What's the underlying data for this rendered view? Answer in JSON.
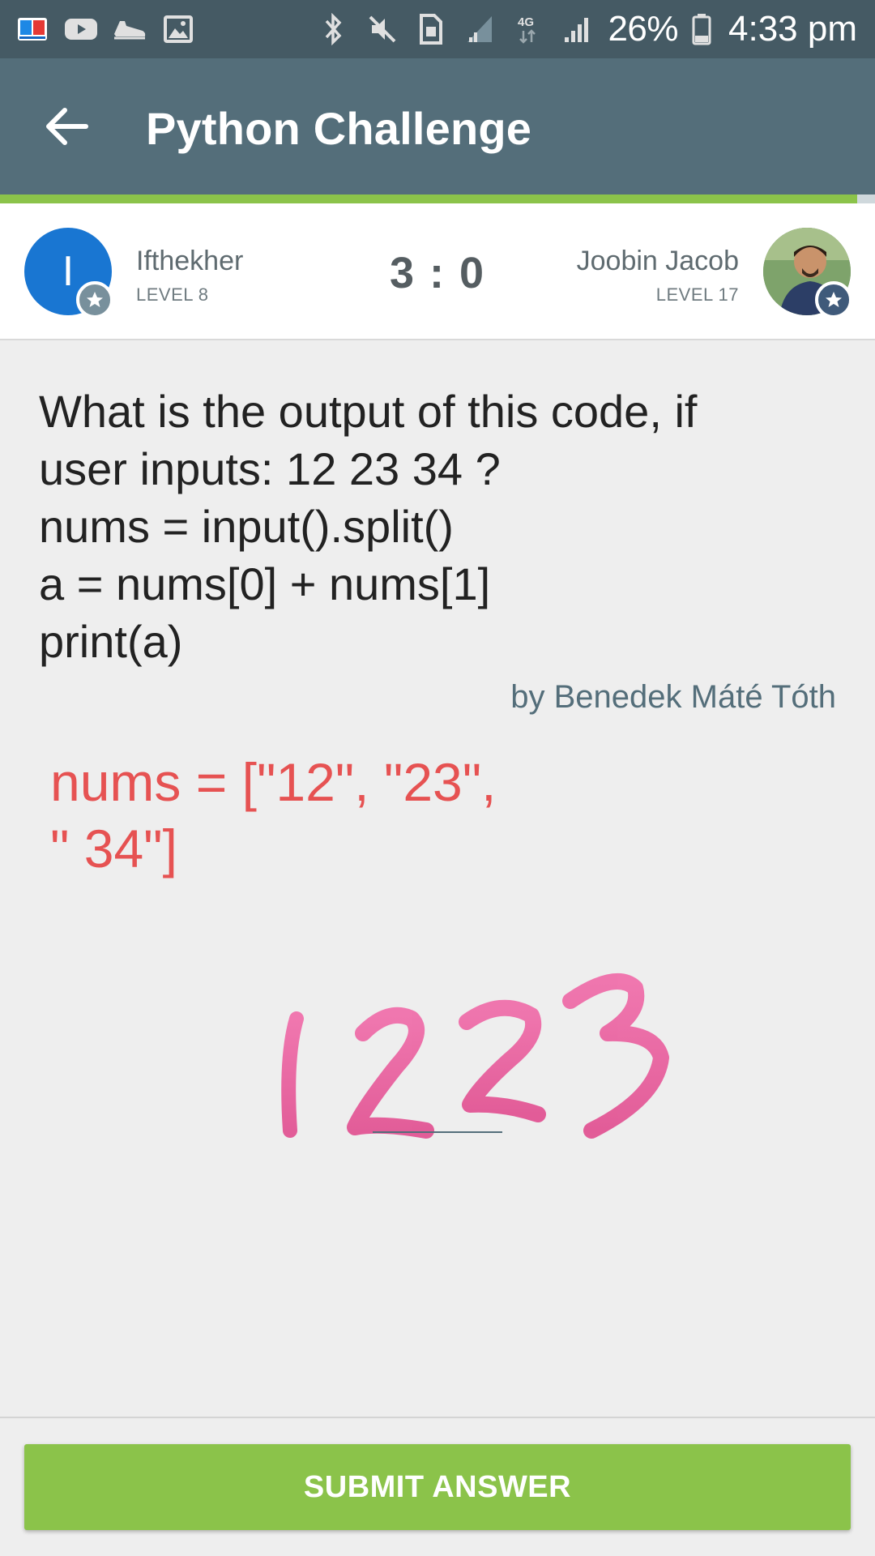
{
  "status_bar": {
    "battery": "26%",
    "time": "4:33 pm",
    "icons_left": [
      "dictionary-app-icon",
      "youtube-icon",
      "shoe-icon",
      "image-icon"
    ],
    "icons_right": [
      "bluetooth-icon",
      "mute-icon",
      "sim-icon",
      "signal-icon",
      "4g-icon",
      "signal-icon",
      "battery-icon"
    ]
  },
  "app_bar": {
    "title": "Python Challenge",
    "back_icon": "arrow-left-icon",
    "progress": 0.98,
    "progress_color": "#8bc34a"
  },
  "players": {
    "left": {
      "initial": "I",
      "name": "Ifthekher",
      "level": "LEVEL 8"
    },
    "right": {
      "name": "Joobin Jacob",
      "level": "LEVEL 17"
    },
    "score": "3 : 0"
  },
  "question": {
    "lines": [
      "What is the output of this code, if",
      "user inputs: 12 23 34 ?",
      "nums = input().split()",
      "a = nums[0] + nums[1]",
      "print(a)"
    ],
    "author": "by Benedek Máté Tóth"
  },
  "annotation": {
    "lines": [
      "nums = [\"12\", \"23\",",
      "\" 34\"]"
    ],
    "scribble": "1223",
    "color": "#e65252",
    "scribble_color": "#ec5f9c"
  },
  "submit": {
    "label": "SUBMIT ANSWER",
    "color": "#8bc34a"
  }
}
